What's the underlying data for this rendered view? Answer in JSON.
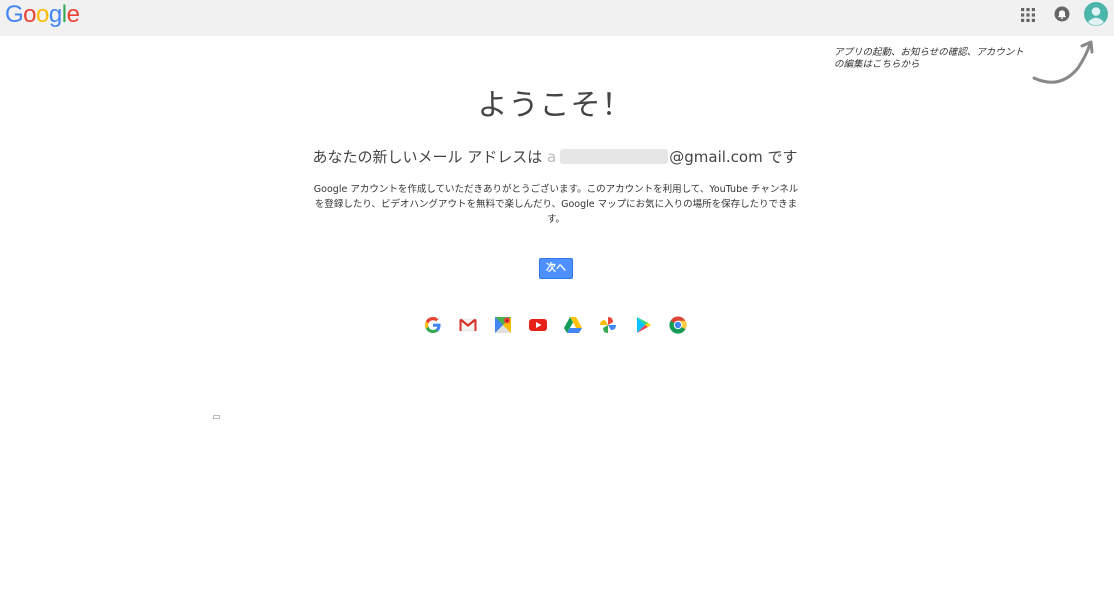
{
  "header": {
    "logo_text": [
      "G",
      "o",
      "o",
      "g",
      "l",
      "e"
    ],
    "logo_colors": [
      "#4285f4",
      "#ea4335",
      "#fbbc05",
      "#4285f4",
      "#34a853",
      "#ea4335"
    ],
    "icons": [
      "apps-grid-icon",
      "notifications-bell-icon",
      "account-avatar-icon"
    ]
  },
  "hint": {
    "text": "アプリの起動、お知らせの確認、アカウントの編集はこちらから"
  },
  "main": {
    "title": "ようこそ！",
    "email_prefix": "あなたの新しいメール アドレスは",
    "email_visible_start": "a",
    "email_domain": "@gmail.com",
    "email_suffix": "です",
    "description": "Google アカウントを作成していただきありがとうございます。このアカウントを利用して、YouTube チャンネルを登録したり、ビデオハングアウトを無料で楽しんだり、Google マップにお気に入りの場所を保存したりできます。",
    "next_button": "次へ"
  },
  "products": [
    {
      "name": "google-search-icon"
    },
    {
      "name": "gmail-icon"
    },
    {
      "name": "maps-icon"
    },
    {
      "name": "youtube-icon"
    },
    {
      "name": "drive-icon"
    },
    {
      "name": "photos-icon"
    },
    {
      "name": "play-store-icon"
    },
    {
      "name": "chrome-icon"
    }
  ],
  "colors": {
    "accent_blue": "#4d90fe",
    "topbar_bg": "#f1f1f1"
  }
}
